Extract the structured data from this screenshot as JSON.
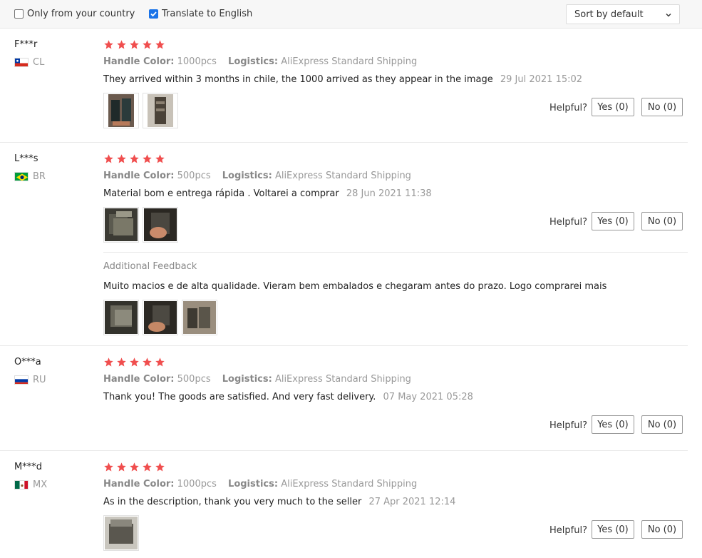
{
  "filters": {
    "only_country_label": "Only from your country",
    "only_country_checked": false,
    "translate_label": "Translate to English",
    "translate_checked": true,
    "sort_label": "Sort by default"
  },
  "labels": {
    "handle_color": "Handle Color:",
    "logistics": "Logistics:",
    "helpful": "Helpful?",
    "additional_feedback": "Additional Feedback"
  },
  "reviews": [
    {
      "user": "F***r",
      "country": "CL",
      "rating": 5,
      "handle_color": "1000pcs",
      "logistics": "AliExpress Standard Shipping",
      "text": "They arrived within 3 months in chile, the 1000 arrived as they appear in the image",
      "date": "29 Jul 2021 15:02",
      "yes": "Yes (0)",
      "no": "No (0)"
    },
    {
      "user": "L***s",
      "country": "BR",
      "rating": 5,
      "handle_color": "500pcs",
      "logistics": "AliExpress Standard Shipping",
      "text": "Material bom e entrega rápida . Voltarei a comprar",
      "date": "28 Jun 2021 11:38",
      "yes": "Yes (0)",
      "no": "No (0)",
      "additional_text": "Muito macios e de alta qualidade. Vieram bem embalados e chegaram antes do prazo. Logo comprarei mais"
    },
    {
      "user": "O***a",
      "country": "RU",
      "rating": 5,
      "handle_color": "500pcs",
      "logistics": "AliExpress Standard Shipping",
      "text": "Thank you! The goods are satisfied. And very fast delivery.",
      "date": "07 May 2021 05:28",
      "yes": "Yes (0)",
      "no": "No (0)"
    },
    {
      "user": "M***d",
      "country": "MX",
      "rating": 5,
      "handle_color": "1000pcs",
      "logistics": "AliExpress Standard Shipping",
      "text": "As in the description, thank you very much to the seller",
      "date": "27 Apr 2021 12:14",
      "yes": "Yes (0)",
      "no": "No (0)"
    }
  ],
  "colors": {
    "star": "#f04e4e",
    "checkbox": "#1a73e8"
  }
}
